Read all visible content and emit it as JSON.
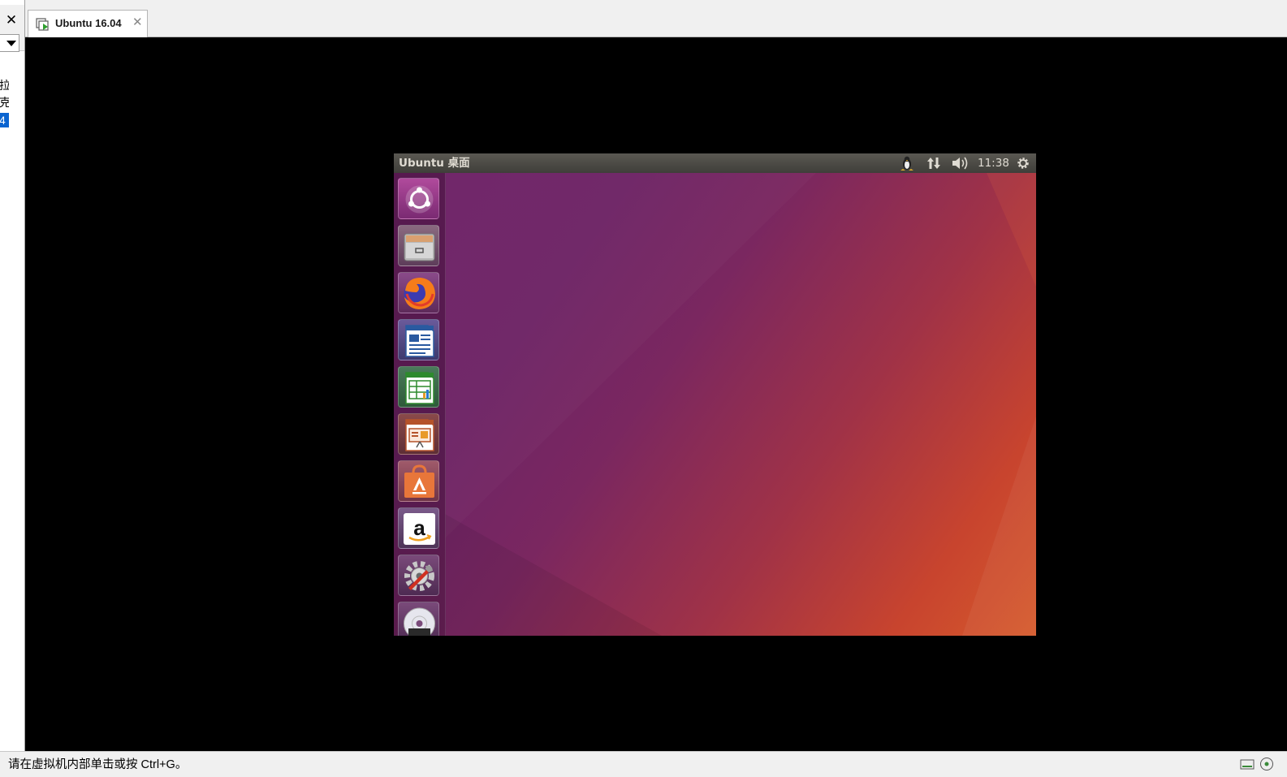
{
  "left_panel": {
    "close_label": "✕",
    "library_items": [
      "拉",
      "克",
      "4"
    ]
  },
  "tab": {
    "title": "Ubuntu 16.04",
    "close_label": "✕"
  },
  "guest": {
    "panel_title": "Ubuntu 桌面",
    "clock": "11:38",
    "indicators": [
      "penguin-icon",
      "network-arrows-icon",
      "volume-icon",
      "gear-icon"
    ],
    "launcher_apps": [
      "Dash",
      "Files",
      "Firefox",
      "LibreOffice Writer",
      "LibreOffice Calc",
      "LibreOffice Impress",
      "Ubuntu Software",
      "Amazon",
      "System Settings",
      "DVD"
    ]
  },
  "colors": {
    "console_bg": "#000000",
    "panel_bg": "#3f3e3a",
    "wallpaper_purple": "#6e2167",
    "wallpaper_orange": "#d55a2c",
    "selection_blue": "#0a64d0"
  },
  "status": {
    "hint": "请在虚拟机内部单击或按 Ctrl+G。"
  }
}
